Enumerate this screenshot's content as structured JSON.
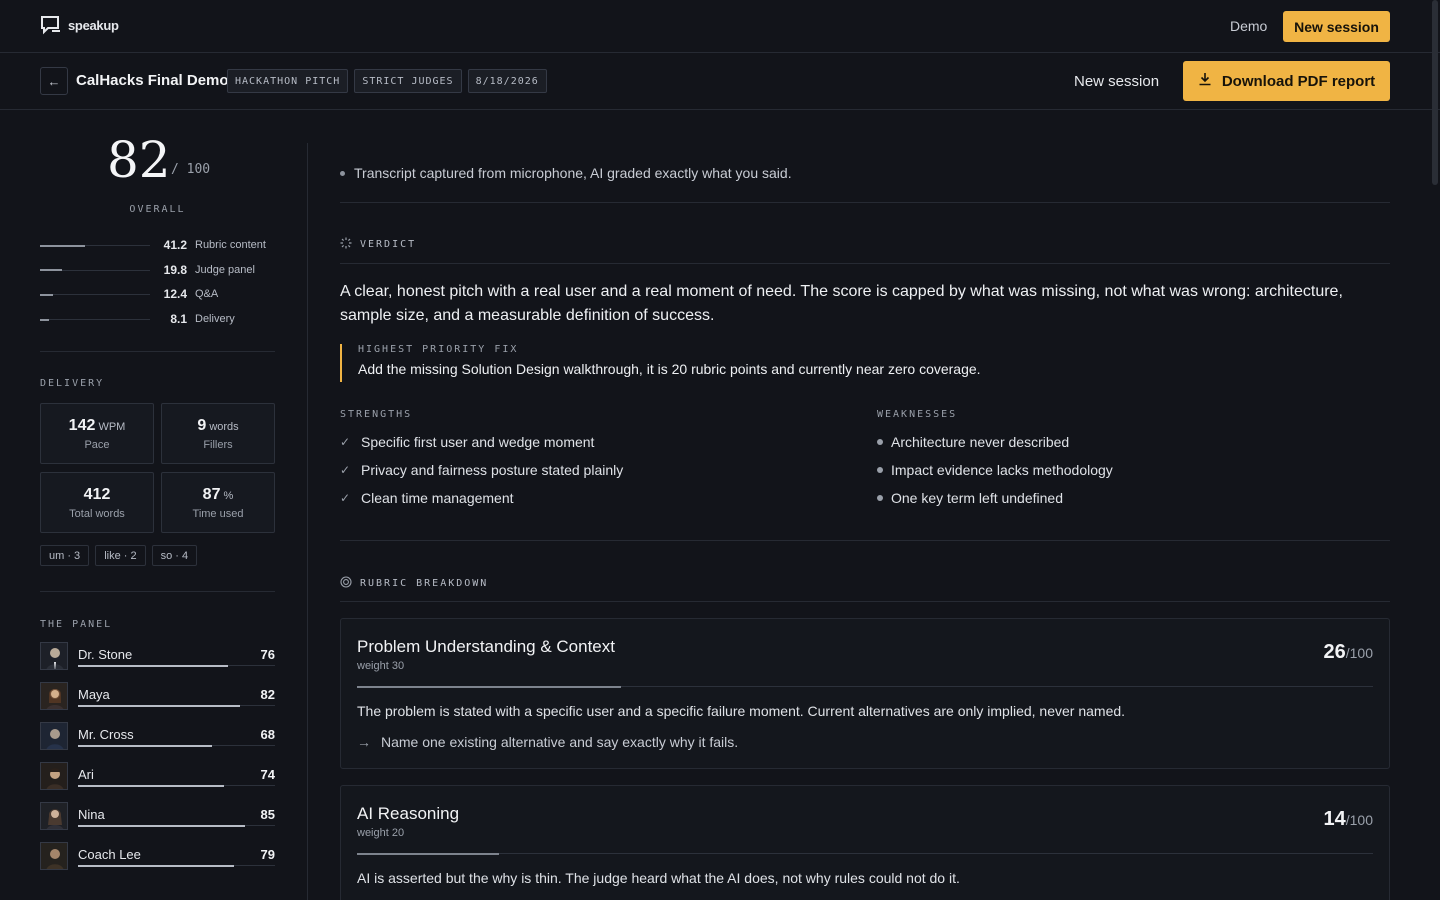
{
  "app": {
    "brand": "speakup",
    "demo_link": "Demo",
    "new_session": "New session"
  },
  "session": {
    "title": "CalHacks Final Demo",
    "tags": [
      "HACKATHON PITCH",
      "STRICT JUDGES",
      "8/18/2026"
    ],
    "new_session": "New session",
    "download_pdf": "Download PDF report"
  },
  "score": {
    "overall": "82",
    "denominator": "/ 100",
    "overall_label": "OVERALL",
    "breakdown": [
      {
        "value": "41.2",
        "label": "Rubric content",
        "fraction": 0.41
      },
      {
        "value": "19.8",
        "label": "Judge panel",
        "fraction": 0.2
      },
      {
        "value": "12.4",
        "label": "Q&A",
        "fraction": 0.12
      },
      {
        "value": "8.1",
        "label": "Delivery",
        "fraction": 0.08
      }
    ]
  },
  "delivery": {
    "label": "DELIVERY",
    "stats": [
      {
        "value": "142",
        "unit": "WPM",
        "label": "Pace"
      },
      {
        "value": "9",
        "unit": "words",
        "label": "Fillers"
      },
      {
        "value": "412",
        "unit": "",
        "label": "Total words"
      },
      {
        "value": "87",
        "unit": "%",
        "label": "Time used"
      }
    ],
    "fillers": [
      "um · 3",
      "like · 2",
      "so · 4"
    ]
  },
  "panel": {
    "label": "THE PANEL",
    "judges": [
      {
        "name": "Dr. Stone",
        "score": "76"
      },
      {
        "name": "Maya",
        "score": "82"
      },
      {
        "name": "Mr. Cross",
        "score": "68"
      },
      {
        "name": "Ari",
        "score": "74"
      },
      {
        "name": "Nina",
        "score": "85"
      },
      {
        "name": "Coach Lee",
        "score": "79"
      }
    ]
  },
  "main": {
    "transcript_note": "Transcript captured from microphone, AI graded exactly what you said.",
    "verdict_label": "VERDICT",
    "verdict_text": "A clear, honest pitch with a real user and a real moment of need. The score is capped by what was missing, not what was wrong: architecture, sample size, and a measurable definition of success.",
    "priority_label": "HIGHEST PRIORITY FIX",
    "priority_text": "Add the missing Solution Design walkthrough, it is 20 rubric points and currently near zero coverage.",
    "strengths_label": "STRENGTHS",
    "strengths": [
      "Specific first user and wedge moment",
      "Privacy and fairness posture stated plainly",
      "Clean time management"
    ],
    "weaknesses_label": "WEAKNESSES",
    "weaknesses": [
      "Architecture never described",
      "Impact evidence lacks methodology",
      "One key term left undefined"
    ],
    "rubric_label": "RUBRIC BREAKDOWN",
    "rubric": [
      {
        "title": "Problem Understanding & Context",
        "weight": "weight 30",
        "score": "26",
        "out_of": "/100",
        "body": "The problem is stated with a specific user and a specific failure moment. Current alternatives are only implied, never named.",
        "action": "Name one existing alternative and say exactly why it fails."
      },
      {
        "title": "AI Reasoning",
        "weight": "weight 20",
        "score": "14",
        "out_of": "/100",
        "body": "AI is asserted but the why is thin. The judge heard what the AI does, not why rules could not do it."
      }
    ]
  },
  "colors": {
    "background": "#12141a",
    "accent": "#f0b444",
    "border": "#262a33"
  }
}
